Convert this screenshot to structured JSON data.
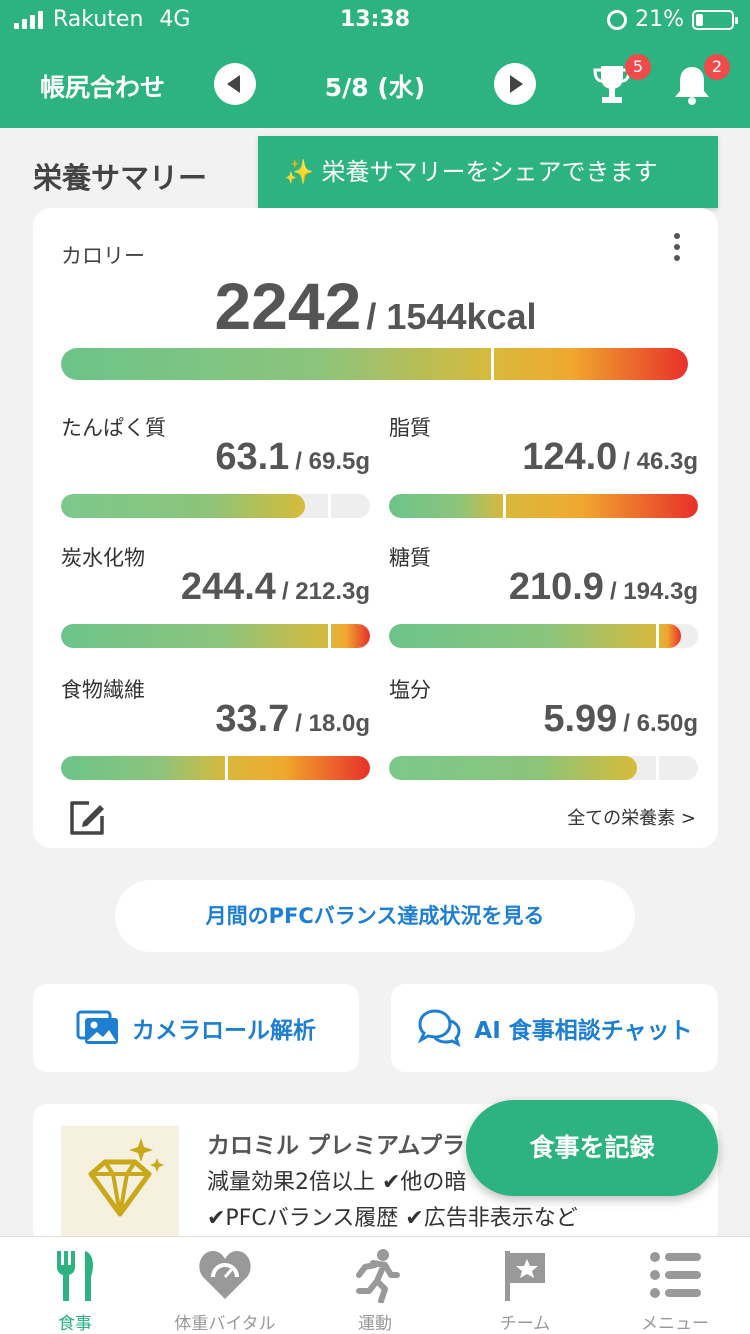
{
  "status_bar": {
    "carrier": "Rakuten",
    "network": "4G",
    "time": "13:38",
    "battery": "21%"
  },
  "header": {
    "title": "帳尻合わせ",
    "date": "5/8 (水)",
    "trophy_badge": "5",
    "bell_badge": "2"
  },
  "section": {
    "title": "栄養サマリー",
    "tooltip": "✨ 栄養サマリーをシェアできます"
  },
  "calorie": {
    "label": "カロリー",
    "value": "2242",
    "target": "/ 1544kcal",
    "ratio": 1.452
  },
  "nutrients": [
    {
      "label": "たんぱく質",
      "value": "63.1",
      "target": "/ 69.5g",
      "ratio": 0.908
    },
    {
      "label": "脂質",
      "value": "124.0",
      "target": "/ 46.3g",
      "ratio": 2.678
    },
    {
      "label": "炭水化物",
      "value": "244.4",
      "target": "/ 212.3g",
      "ratio": 1.151
    },
    {
      "label": "糖質",
      "value": "210.9",
      "target": "/ 194.3g",
      "ratio": 1.085
    },
    {
      "label": "食物繊維",
      "value": "33.7",
      "target": "/ 18.0g",
      "ratio": 1.872
    },
    {
      "label": "塩分",
      "value": "5.99",
      "target": "/ 6.50g",
      "ratio": 0.922
    }
  ],
  "all_nutrients_link": "全ての栄養素 >",
  "pfc_button": "月間のPFCバランス達成状況を見る",
  "tiles": {
    "camera": "カメラロール解析",
    "ai_chat": "AI 食事相談チャット"
  },
  "promo": {
    "title": "カロミル プレミアムプラン",
    "line1": "減量効果2倍以上 ✔他の暗",
    "line2": "✔PFCバランス履歴 ✔広告非表示など"
  },
  "fab": "食事を記録",
  "tabs": [
    "食事",
    "体重バイタル",
    "運動",
    "チーム",
    "メニュー"
  ],
  "colors": {
    "brand": "#2db281",
    "link": "#1e7fd2",
    "badge": "#ef4b4b"
  }
}
